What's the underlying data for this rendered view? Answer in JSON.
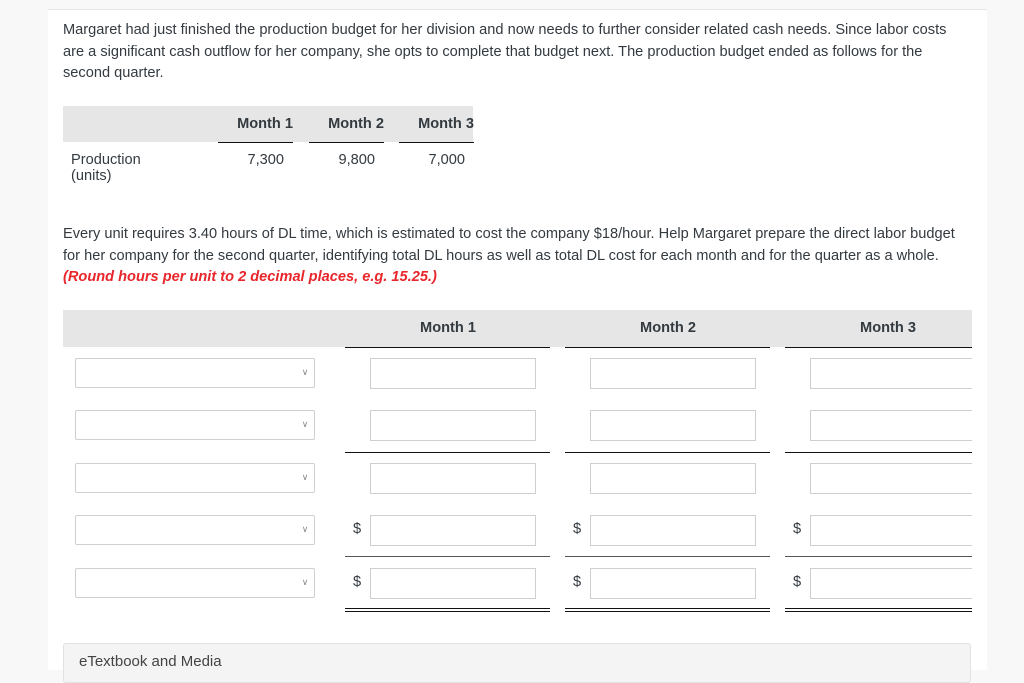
{
  "intro": "Margaret had just finished the production budget for her division and now needs to further consider related cash needs. Since labor costs are a significant cash outflow for her company, she opts to complete that budget next. The production budget ended as follows for the second quarter.",
  "production_table": {
    "columns": [
      "Month 1",
      "Month 2",
      "Month 3"
    ],
    "row_label": "Production (units)",
    "values": [
      "7,300",
      "9,800",
      "7,000"
    ]
  },
  "instructions": "Every unit requires 3.40 hours of DL time, which is estimated to cost the company $18/hour. Help Margaret prepare the direct labor budget for her company for the second quarter, identifying total DL hours as well as total DL cost for each month and for the quarter as a whole.",
  "hint": "(Round hours per unit to 2 decimal places, e.g. 15.25.)",
  "budget_table": {
    "columns": [
      "Month 1",
      "Month 2",
      "Month 3"
    ],
    "rows": [
      {
        "select_value": "",
        "currency": "",
        "values": [
          "",
          "",
          ""
        ]
      },
      {
        "select_value": "",
        "currency": "",
        "values": [
          "",
          "",
          ""
        ]
      },
      {
        "select_value": "",
        "currency": "",
        "values": [
          "",
          "",
          ""
        ]
      },
      {
        "select_value": "",
        "currency": "$",
        "values": [
          "",
          "",
          ""
        ]
      },
      {
        "select_value": "",
        "currency": "$",
        "values": [
          "",
          "",
          ""
        ]
      }
    ]
  },
  "icons": {
    "dropdown": "chevron-down-icon"
  },
  "footer": {
    "etextbook_label": "eTextbook and Media"
  },
  "colors": {
    "hint": "#e8262b",
    "header_bg": "#e6e6e6",
    "text": "#333a40"
  }
}
